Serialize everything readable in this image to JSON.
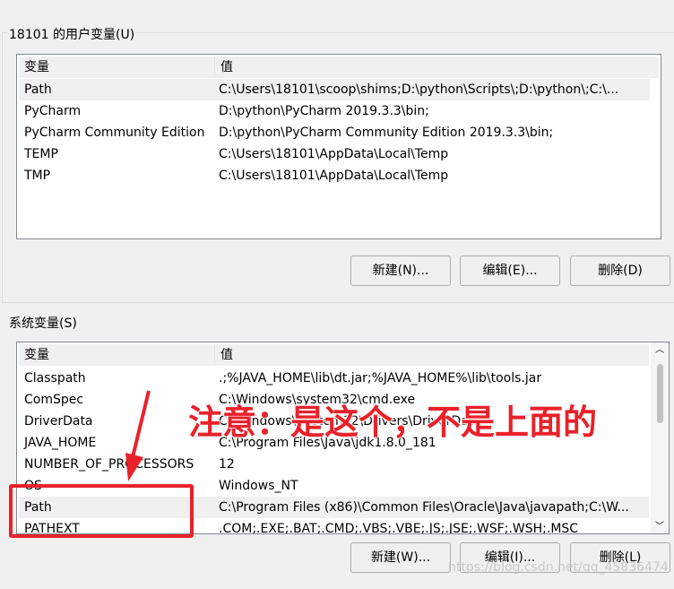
{
  "user_vars": {
    "title": "18101 的用户变量(U)",
    "col_name": "变量",
    "col_value": "值",
    "rows": [
      {
        "name": "Path",
        "value": "C:\\Users\\18101\\scoop\\shims;D:\\python\\Scripts\\;D:\\python\\;C:\\..."
      },
      {
        "name": "PyCharm",
        "value": "D:\\python\\PyCharm 2019.3.3\\bin;"
      },
      {
        "name": "PyCharm Community Edition",
        "value": "D:\\python\\PyCharm Community Edition 2019.3.3\\bin;"
      },
      {
        "name": "TEMP",
        "value": "C:\\Users\\18101\\AppData\\Local\\Temp"
      },
      {
        "name": "TMP",
        "value": "C:\\Users\\18101\\AppData\\Local\\Temp"
      }
    ],
    "buttons": {
      "new": "新建(N)...",
      "edit": "编辑(E)...",
      "delete": "删除(D)"
    }
  },
  "sys_vars": {
    "title": "系统变量(S)",
    "col_name": "变量",
    "col_value": "值",
    "rows": [
      {
        "name": "Classpath",
        "value": ".;%JAVA_HOME\\lib\\dt.jar;%JAVA_HOME%\\lib\\tools.jar"
      },
      {
        "name": "ComSpec",
        "value": "C:\\Windows\\system32\\cmd.exe"
      },
      {
        "name": "DriverData",
        "value": "C:\\Windows\\System32\\Drivers\\DriverData"
      },
      {
        "name": "JAVA_HOME",
        "value": "C:\\Program Files\\Java\\jdk1.8.0_181"
      },
      {
        "name": "NUMBER_OF_PROCESSORS",
        "value": "12"
      },
      {
        "name": "OS",
        "value": "Windows_NT"
      },
      {
        "name": "Path",
        "value": "C:\\Program Files (x86)\\Common Files\\Oracle\\Java\\javapath;C:\\W..."
      },
      {
        "name": "PATHEXT",
        "value": ".COM;.EXE;.BAT;.CMD;.VBS;.VBE;.JS;.JSE;.WSF;.WSH;.MSC"
      }
    ],
    "buttons": {
      "new": "新建(W)...",
      "edit": "编辑(I)...",
      "delete": "删除(L)"
    }
  },
  "annotation": {
    "text": "注意：是这个，不是上面的",
    "color": "#e8222b"
  },
  "watermark": "https://blog.csdn.net/qq_45836474"
}
